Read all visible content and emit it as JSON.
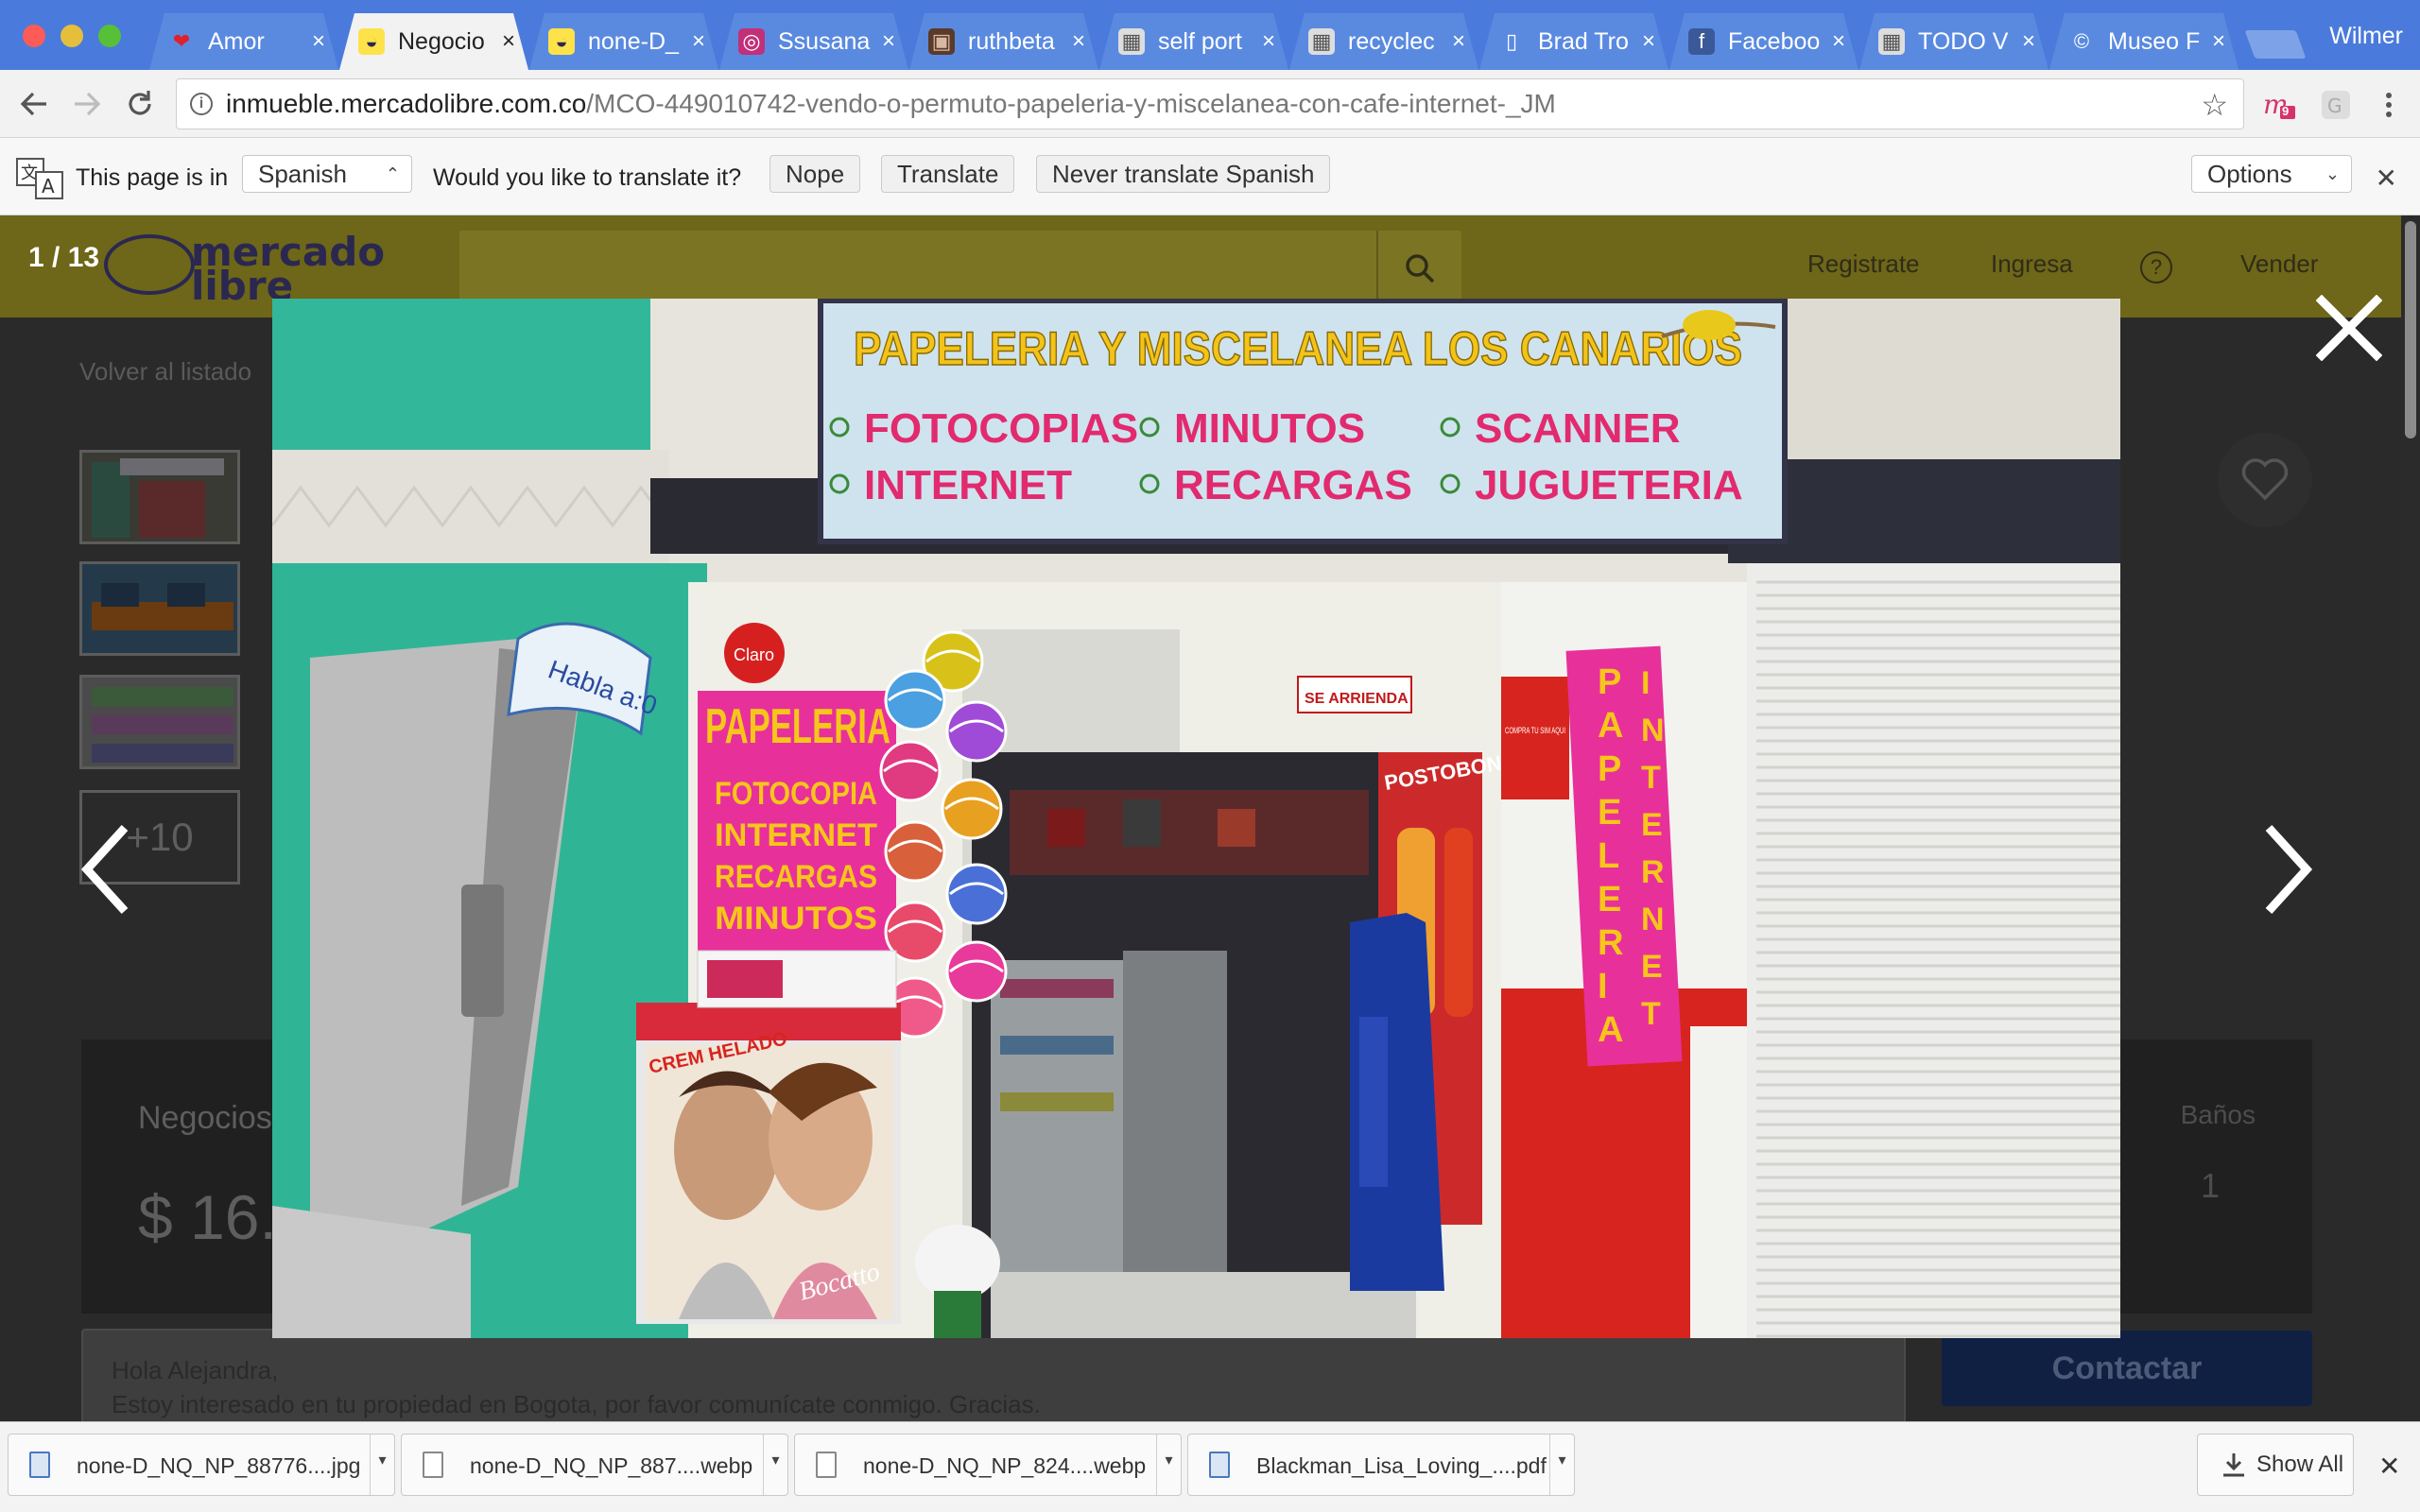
{
  "browser": {
    "profile_name": "Wilmer",
    "tabs": [
      {
        "label": "Amor",
        "icon": "heart-icon",
        "active": false
      },
      {
        "label": "Negocio",
        "icon": "mercadolibre-icon",
        "active": true
      },
      {
        "label": "none-D_",
        "icon": "mercadolibre-icon",
        "active": false
      },
      {
        "label": "Ssusana",
        "icon": "instagram-icon",
        "active": false
      },
      {
        "label": "ruthbeta",
        "icon": "photo-icon",
        "active": false
      },
      {
        "label": "self port",
        "icon": "image-icon",
        "active": false
      },
      {
        "label": "recyclec",
        "icon": "image-icon",
        "active": false
      },
      {
        "label": "Brad Tro",
        "icon": "document-icon",
        "active": false
      },
      {
        "label": "Faceboo",
        "icon": "facebook-icon",
        "active": false
      },
      {
        "label": "TODO V",
        "icon": "image-icon",
        "active": false
      },
      {
        "label": "Museo F",
        "icon": "copyright-icon",
        "active": false
      }
    ],
    "url_host": "inmueble.mercadolibre.com.co",
    "url_path": "/MCO-449010742-vendo-o-permuto-papeleria-y-miscelanea-con-cafe-internet-_JM",
    "extension_badge": "9"
  },
  "translate_bar": {
    "prefix": "This page is in",
    "language": "Spanish",
    "question": "Would you like to translate it?",
    "nope": "Nope",
    "translate": "Translate",
    "never": "Never translate Spanish",
    "options": "Options"
  },
  "page": {
    "logo_line1": "mercado",
    "logo_line2": "libre",
    "nav_register": "Registrate",
    "nav_login": "Ingresa",
    "nav_help": "?",
    "nav_sell": "Vender",
    "back_link": "Volver al listado",
    "more_photos": "+10",
    "listing_title": "Negocios",
    "price": "$ 16.",
    "bathrooms_label": "Baños",
    "bathrooms_value": "1",
    "message_line1": "Hola Alejandra,",
    "message_line2": "Estoy interesado en tu propiedad en Bogota, por favor comunícate conmigo. Gracias.",
    "contact_button": "Contactar"
  },
  "lightbox": {
    "counter": "1 / 13",
    "photo": {
      "sign_title": "PAPELERIA Y MISCELANEA LOS CANARIOS",
      "sign_items": [
        "FOTOCOPIAS",
        "INTERNET",
        "MINUTOS",
        "RECARGAS",
        "SCANNER",
        "JUGUETERIA"
      ],
      "booth_label": "Habla a:0",
      "banner_title": "PAPELERIA",
      "banner_items": [
        "FOTOCOPIA",
        "INTERNET",
        "RECARGAS",
        "MINUTOS"
      ],
      "vertical_sign": "PAPELERIA",
      "vertical_sign2": "INTERNET",
      "for_rent": "SE ARRIENDA",
      "claro": "Claro",
      "recharge_sign": "COMPRA TU SIM AQUI",
      "freezer_brand": "CREM HELADO",
      "ice_cream": "Bocatto",
      "drink_brand": "POSTOBON"
    }
  },
  "downloads": {
    "items": [
      "none-D_NQ_NP_88776....jpg",
      "none-D_NQ_NP_887....webp",
      "none-D_NQ_NP_824....webp",
      "Blackman_Lisa_Loving_....pdf"
    ],
    "show_all": "Show All"
  }
}
